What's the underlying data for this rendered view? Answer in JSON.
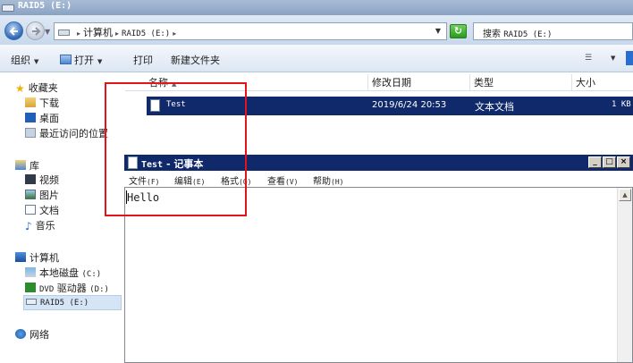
{
  "explorer": {
    "title": "RAID5 (E:)",
    "address": {
      "part1": "计算机",
      "part2": "RAID5 (E:)"
    },
    "search_placeholder": {
      "label": "搜索",
      "target": "RAID5 (E:)"
    },
    "toolbar": {
      "organize": "组织",
      "open": "打开",
      "print": "打印",
      "new_folder": "新建文件夹"
    },
    "nav": {
      "favorites": "收藏夹",
      "downloads": "下载",
      "desktop": "桌面",
      "recent": "最近访问的位置",
      "libraries": "库",
      "videos": "视频",
      "pictures": "图片",
      "documents": "文档",
      "music": "音乐",
      "computer": "计算机",
      "local_disk_label": "本地磁盘",
      "local_disk_drive": "(C:)",
      "dvd_prefix": "DVD",
      "dvd_label": "驱动器",
      "dvd_drive": "(D:)",
      "raid5": "RAID5 (E:)",
      "network": "网络"
    },
    "columns": {
      "name": "名称",
      "date_modified": "修改日期",
      "type": "类型",
      "size": "大小"
    },
    "files": [
      {
        "name": "Test",
        "date_modified": "2019/6/24 20:53",
        "type": "文本文档",
        "size": "1 KB"
      }
    ]
  },
  "notepad": {
    "title_file": "Test",
    "title_sep": "-",
    "title_app": "记事本",
    "menu": [
      {
        "label": "文件",
        "key": "(F)"
      },
      {
        "label": "编辑",
        "key": "(E)"
      },
      {
        "label": "格式",
        "key": "(O)"
      },
      {
        "label": "查看",
        "key": "(V)"
      },
      {
        "label": "帮助",
        "key": "(H)"
      }
    ],
    "content": "Hello"
  },
  "colors": {
    "selection": "#10296b",
    "annotation": "#e3131b"
  }
}
